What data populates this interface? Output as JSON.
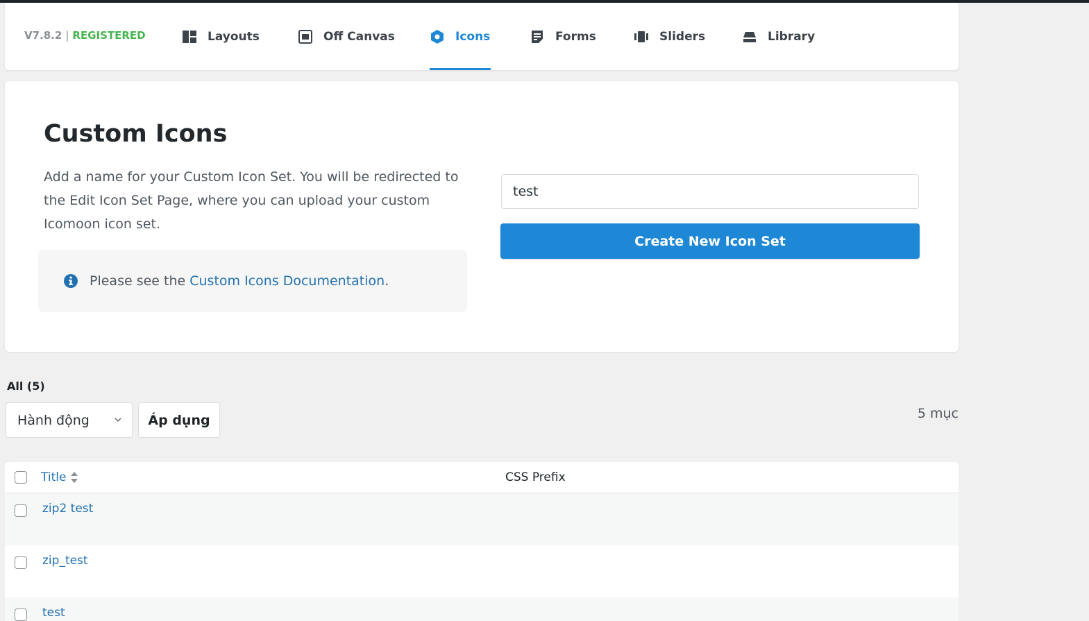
{
  "header": {
    "version": "V7.8.2",
    "separator": "|",
    "status": "REGISTERED",
    "nav": [
      {
        "label": "Layouts",
        "icon": "layouts-icon"
      },
      {
        "label": "Off Canvas",
        "icon": "off-canvas-icon"
      },
      {
        "label": "Icons",
        "icon": "icons-icon",
        "active": true
      },
      {
        "label": "Forms",
        "icon": "forms-icon"
      },
      {
        "label": "Sliders",
        "icon": "sliders-icon"
      },
      {
        "label": "Library",
        "icon": "library-icon"
      }
    ]
  },
  "main": {
    "title": "Custom Icons",
    "description": "Add a name for your Custom Icon Set. You will be redirected to the Edit Icon Set Page, where you can upload your custom Icomoon icon set.",
    "notice": {
      "prefix": "Please see the ",
      "link": "Custom Icons Documentation",
      "suffix": "."
    },
    "name_input_value": "test",
    "create_button": "Create New Icon Set"
  },
  "list": {
    "filter_all": "All (5)",
    "bulk_action": "Hành động",
    "apply": "Áp dụng",
    "count": "5 mục",
    "columns": {
      "title": "Title",
      "css_prefix": "CSS Prefix"
    },
    "rows": [
      {
        "title": "zip2 test"
      },
      {
        "title": "zip_test"
      },
      {
        "title": "test"
      }
    ]
  },
  "colors": {
    "accent": "#1e88d6",
    "registered": "#46b450",
    "link": "#2271b1"
  }
}
